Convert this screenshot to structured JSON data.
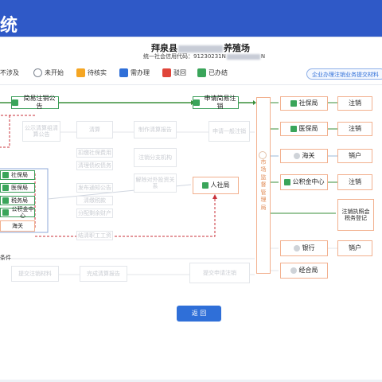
{
  "header": {
    "title": "统"
  },
  "company": {
    "name_prefix": "拜泉县",
    "name_suffix": "养殖场",
    "credit_code": "统一社会信用代码：91230231N",
    "credit_code_suffix": "N"
  },
  "legend": [
    {
      "label": "不涉及",
      "color": "#9aa0a6"
    },
    {
      "label": "未开始",
      "color": "#7d8590"
    },
    {
      "label": "待核实",
      "color": "#f5a623"
    },
    {
      "label": "需办理",
      "color": "#2f6fd8"
    },
    {
      "label": "驳回",
      "color": "#e0453a"
    },
    {
      "label": "已办结",
      "color": "#3aa55a"
    }
  ],
  "notice_link": "企业办理注销业务提交材料",
  "flow": {
    "simple_notice": "简易注销公告",
    "apply_simple": "申请简易注销",
    "market_bureau": "市场监督管理局",
    "hrss": "人社局",
    "left_nodes": [
      "社保局",
      "医保局",
      "税务局",
      "公积金中心",
      "海关"
    ],
    "gray_nodes": [
      "公示清算组清算公告",
      "清算",
      "制作清算报告",
      "申请一般注销",
      "注销分支机构",
      "解除对外投资关系",
      "扣缴社保费用",
      "清理债权债务",
      "发布通知公告",
      "分配剩余财产",
      "清缴税款",
      "结清职工工资",
      "完成清算报告",
      "提交申请注销",
      "提交注销材料"
    ],
    "right_depts": [
      "社保局",
      "医保局",
      "海关",
      "公积金中心",
      "银行",
      "经合局"
    ],
    "right_actions": [
      "注销",
      "注销",
      "销户",
      "注销",
      "注销执照会税务登记",
      "销户"
    ],
    "condition_label": "条件"
  },
  "buttons": {
    "back": "返 回"
  }
}
